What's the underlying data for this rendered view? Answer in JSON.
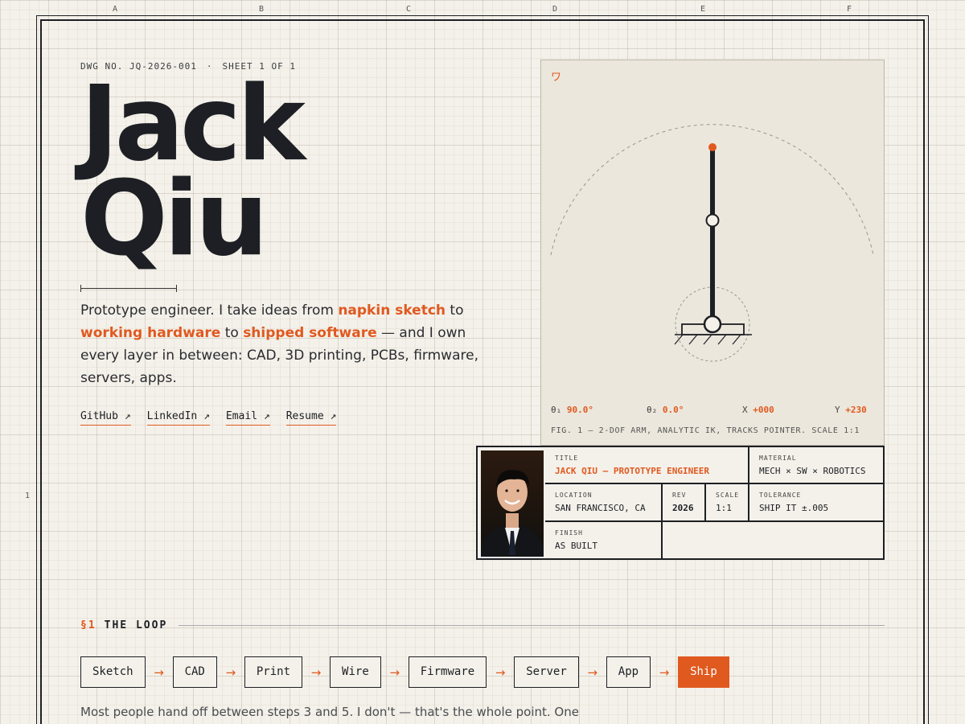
{
  "grid": {
    "columns": [
      "A",
      "B",
      "C",
      "D",
      "E",
      "F"
    ],
    "row": "1"
  },
  "header": {
    "drawing_number": "DWG NO. JQ-2026-001",
    "separator": "·",
    "sheet": "SHEET 1 OF 1"
  },
  "hero": {
    "first_name": "Jack",
    "last_name": "Qiu",
    "intro_before": "Prototype engineer. I take ideas from ",
    "intro_hl1": "napkin sketch",
    "intro_mid1": " to ",
    "intro_hl2": "working hardware",
    "intro_mid2": " to ",
    "intro_hl3": "shipped software",
    "intro_after": " — and I own every layer in between: CAD, 3D printing, PCBs, firmware, servers, apps."
  },
  "links": [
    {
      "label": "GitHub ↗"
    },
    {
      "label": "LinkedIn ↗"
    },
    {
      "label": "Email ↗"
    },
    {
      "label": "Resume ↗"
    }
  ],
  "figure": {
    "logo": "ワ",
    "theta1_label": "θ₁",
    "theta1_value": "90.0°",
    "theta2_label": "θ₂",
    "theta2_value": "0.0°",
    "x_label": "X",
    "x_value": "+000",
    "y_label": "Y",
    "y_value": "+230",
    "caption": "FIG. 1 — 2-DOF ARM, ANALYTIC IK, TRACKS POINTER. SCALE 1:1",
    "theta1_deg": 90.0,
    "theta2_deg": 0.0
  },
  "title_block": {
    "title_label": "TITLE",
    "title_value": "JACK QIU — PROTOTYPE ENGINEER",
    "material_label": "MATERIAL",
    "material_value": "MECH × SW × ROBOTICS",
    "location_label": "LOCATION",
    "location_value": "SAN FRANCISCO, CA",
    "rev_label": "REV",
    "rev_value": "2026",
    "scale_label": "SCALE",
    "scale_value": "1:1",
    "tolerance_label": "TOLERANCE",
    "tolerance_value": "SHIP IT ±.005",
    "finish_label": "FINISH",
    "finish_value": "AS BUILT"
  },
  "loop_section": {
    "number": "§1",
    "title": "THE LOOP",
    "steps": [
      "Sketch",
      "CAD",
      "Print",
      "Wire",
      "Firmware",
      "Server",
      "App",
      "Ship"
    ],
    "arrow": "→",
    "note": "Most people hand off between steps 3 and 5. I don't — that's the whole point. One"
  },
  "colors": {
    "accent": "#e0591f",
    "ink": "#1d1f24",
    "paper": "#f4f1ea",
    "figure_bg": "#ece7dc"
  }
}
